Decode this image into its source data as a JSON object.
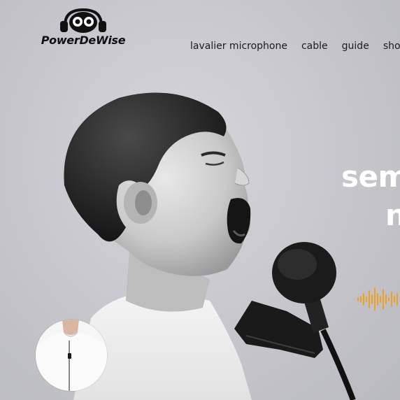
{
  "brand": {
    "name": "PowerDeWise",
    "logo_icon": "headphone-glasses-mascot-icon"
  },
  "nav": {
    "items": [
      {
        "label": "lavalier microphone"
      },
      {
        "label": "cable"
      },
      {
        "label": "guide"
      },
      {
        "label": "shop"
      }
    ]
  },
  "hero": {
    "headline_line1": "sem",
    "headline_line2": "n",
    "image": "boy-shouting-into-lavalier-microphone",
    "thumbnail": "person-wearing-lavalier-mic-thumbnail",
    "wave_icon": "sound-wave-icon",
    "accent_color": "#f0a020"
  }
}
